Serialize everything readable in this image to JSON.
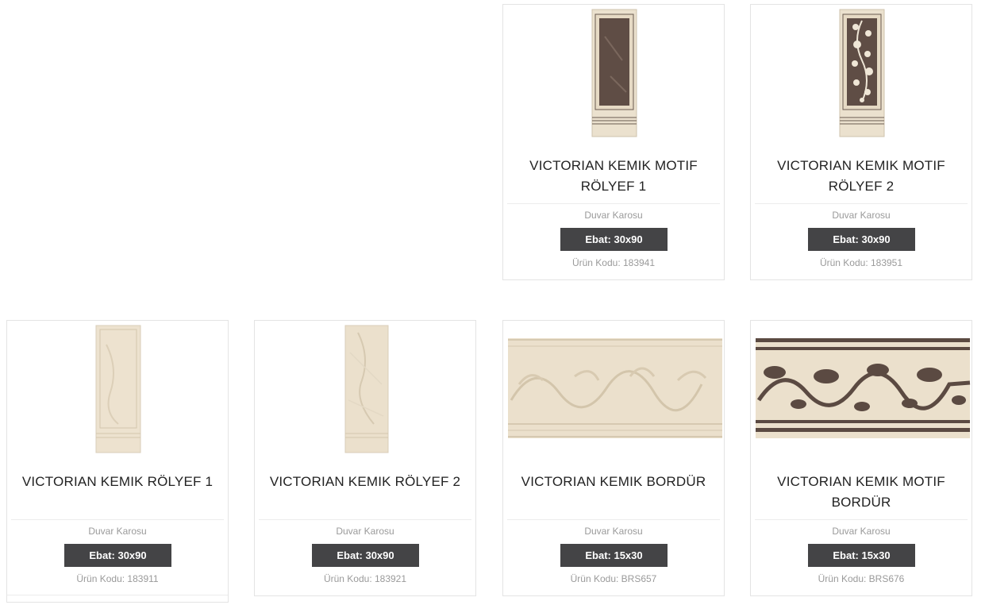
{
  "products": [
    {
      "title_line1": "VICTORIAN KEMIK MOTIF",
      "title_line2": "RÖLYEF 1",
      "category": "Duvar Karosu",
      "size": "Ebat: 30x90",
      "code": "Ürün Kodu: 183941",
      "image": "dark-panel-tile"
    },
    {
      "title_line1": "VICTORIAN KEMIK MOTIF",
      "title_line2": "RÖLYEF 2",
      "category": "Duvar Karosu",
      "size": "Ebat: 30x90",
      "code": "Ürün Kodu: 183951",
      "image": "floral-panel-tile"
    },
    {
      "title_line1": "VICTORIAN KEMIK RÖLYEF 1",
      "title_line2": "",
      "category": "Duvar Karosu",
      "size": "Ebat: 30x90",
      "code": "Ürün Kodu: 183911",
      "image": "cream-relief-tile"
    },
    {
      "title_line1": "VICTORIAN KEMIK RÖLYEF 2",
      "title_line2": "",
      "category": "Duvar Karosu",
      "size": "Ebat: 30x90",
      "code": "Ürün Kodu: 183921",
      "image": "cream-relief-tile"
    },
    {
      "title_line1": "VICTORIAN KEMIK BORDÜR",
      "title_line2": "",
      "category": "Duvar Karosu",
      "size": "Ebat: 15x30",
      "code": "Ürün Kodu: BRS657",
      "image": "cream-border-tile"
    },
    {
      "title_line1": "VICTORIAN KEMIK MOTIF",
      "title_line2": "BORDÜR",
      "category": "Duvar Karosu",
      "size": "Ebat: 15x30",
      "code": "Ürün Kodu: BRS676",
      "image": "dark-motif-border-tile"
    }
  ],
  "colors": {
    "size_badge": "#444446",
    "tile_cream": "#ece0cc",
    "tile_dark": "#5b4a42"
  }
}
